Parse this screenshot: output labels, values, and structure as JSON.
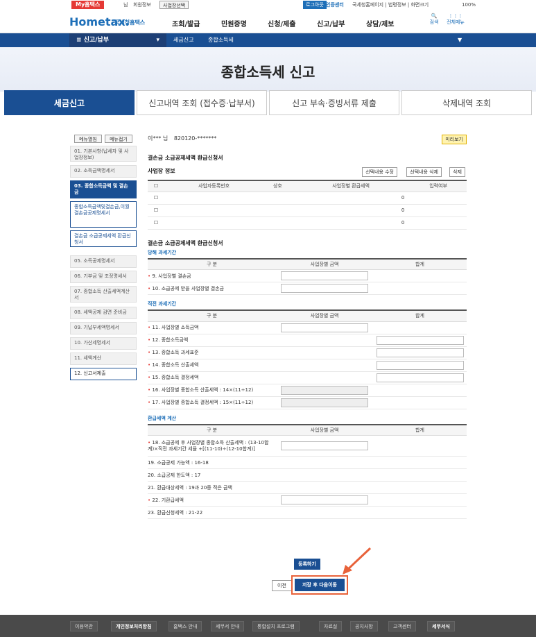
{
  "top": {
    "myhome": "My홈택스",
    "user": "님",
    "member": "회원정보",
    "bizsel": "사업장선택",
    "login": "로그아웃",
    "cert": "인증센터",
    "links": "국세청홈페이지 | 법령정보 | 화면크기",
    "zoom": "100%"
  },
  "header": {
    "logo": "Hometax.",
    "logo_kr": "국세청홈택스",
    "nav": [
      "조회/발급",
      "민원증명",
      "신청/제출",
      "신고/납부",
      "상담/제보"
    ],
    "search": "검색",
    "allmenu": "전체메뉴"
  },
  "location": {
    "current": "신고/납부",
    "crumb1": "세금신고",
    "crumb2": "종합소득세"
  },
  "banner": {
    "title": "종합소득세 신고"
  },
  "tabs": [
    "세금신고",
    "신고내역 조회 (접수증·납부서)",
    "신고 부속·증빙서류 제출",
    "삭제내역 조회"
  ],
  "sidebar": {
    "open": "메뉴열침",
    "close": "메뉴접기",
    "items": [
      "01. 기본사항(납세자 및 사업장정보)",
      "02. 소득금액명세서",
      "03. 종합소득금액 및 결손금",
      "종합소득금액및결손금,이월결손금공제명세서",
      "결손금 소급공제세액 환급신청서",
      "05. 소득공제명세서",
      "06. 기부금 및 조정명세서",
      "07. 종합소득 산출세액계산서",
      "08. 세액공제 감면 준비금",
      "09. 기납부세액명세서",
      "10. 가산세명세서",
      "11. 세액계산",
      "12. 신고서제출"
    ]
  },
  "main": {
    "user": "이*** 님",
    "id": "820120-*******",
    "preview": "미리보기",
    "form_title": "결손금 소급공제세액 환급신청서",
    "biz_title": "사업장 정보",
    "btn_edit": "선택내용 수정",
    "btn_del": "선택내용 삭제",
    "btn_delete": "삭제",
    "biz_cols": [
      "사업자등록번호",
      "상호",
      "사업장별 환급세액",
      "입력여부"
    ],
    "biz_rows": [
      "0",
      "0",
      "0"
    ],
    "app_title": "결손금 소급공제세액 환급신청서",
    "current_period": "당해 과세기간",
    "prior_period": "직전 과세기간",
    "refund_calc": "환급세액 계산",
    "col_gubun": "구 분",
    "col_biz": "사업장별 금액",
    "col_total": "합계",
    "rows_a": [
      "9. 사업장별 결손금",
      "10. 소급공제 받을 사업장별 결손금"
    ],
    "rows_b": [
      "11. 사업장별 소득금액",
      "12. 종합소득금액",
      "13. 종합소득 과세표준",
      "14. 종합소득 산출세액",
      "15. 종합소득 결정세액",
      "16. 사업장별 종합소득 산출세액 : 14×(11÷12)",
      "17. 사업장별 종합소득 결정세액 : 15×(11÷12)"
    ],
    "rows_c": [
      "18. 소급공제 후 사업장별 종합소득 산출세액 : (13-10합계)×직전 과세기간 세율 +[(11-10)÷(12-10합계)]",
      "19. 소급공제 가능액 : 16-18",
      "20. 소급공제 한도액 : 17",
      "21. 환급대상세액 : 19과 20중 적은 금액",
      "22. 기환급세액",
      "23. 환급신청세액 : 21-22"
    ],
    "register": "등록하기",
    "prev": "이전",
    "save_next": "저장 후 다음이동"
  },
  "footer": [
    "이용약관",
    "개인정보처리방침",
    "홈택스 안내",
    "세무서 안내",
    "통합설치 프로그램",
    "자료실",
    "공지사항",
    "고객센터",
    "세무서식"
  ]
}
